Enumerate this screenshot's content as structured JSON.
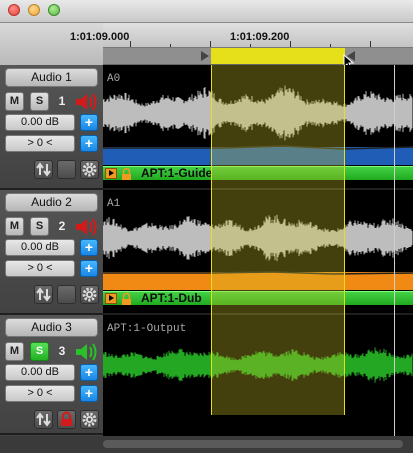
{
  "timeline": {
    "timecodes": [
      "1:01:09.000",
      "1:01:09.200"
    ]
  },
  "tracks": [
    {
      "name": "Audio 1",
      "mute_label": "M",
      "solo_label": "S",
      "solo_active": false,
      "number": "1",
      "speaker": "red-speaker-icon",
      "gain": "0.00 dB",
      "offset": "> 0 <",
      "lock_active": false,
      "region_label": "A0",
      "region_title": "APT:1-Guide",
      "waveform_color": "#bdbdbd",
      "band_color": "#1f5db7"
    },
    {
      "name": "Audio 2",
      "mute_label": "M",
      "solo_label": "S",
      "solo_active": false,
      "number": "2",
      "speaker": "red-speaker-icon",
      "gain": "0.00 dB",
      "offset": "> 0 <",
      "lock_active": false,
      "region_label": "A1",
      "region_title": "APT:1-Dub",
      "waveform_color": "#bdbdbd",
      "band_color": "#f08a14"
    },
    {
      "name": "Audio 3",
      "mute_label": "M",
      "solo_label": "S",
      "solo_active": true,
      "number": "3",
      "speaker": "green-speaker-icon",
      "gain": "0.00 dB",
      "offset": "> 0 <",
      "lock_active": true,
      "region_label": "APT:1-Output",
      "waveform_color": "#24a824"
    }
  ],
  "colors": {
    "selection": "#e6e01b",
    "accent_blue": "#1a86e4",
    "region_green": "#2bbf2b",
    "mute_red": "#d41b1b"
  }
}
